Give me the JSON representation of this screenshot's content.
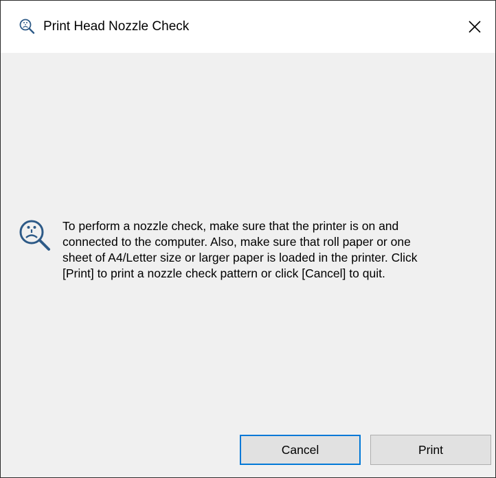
{
  "window": {
    "title": "Print Head Nozzle Check",
    "title_icon": "nozzle-check-magnifier-icon",
    "close_icon": "close-icon"
  },
  "message": {
    "icon": "nozzle-check-magnifier-icon",
    "lines": [
      "To perform a nozzle check, make sure that the printer is on and",
      "connected to the computer. Also, make sure that roll paper or one",
      "sheet of A4/Letter size or larger paper is loaded in the printer. Click",
      "[Print] to print a nozzle check pattern or click [Cancel] to quit."
    ]
  },
  "buttons": {
    "cancel_label": "Cancel",
    "print_label": "Print"
  },
  "colors": {
    "dialog_background": "#f0f0f0",
    "titlebar_background": "#ffffff",
    "icon_blue": "#2d5a87",
    "focus_border": "#0078d7",
    "button_face": "#e1e1e1"
  }
}
